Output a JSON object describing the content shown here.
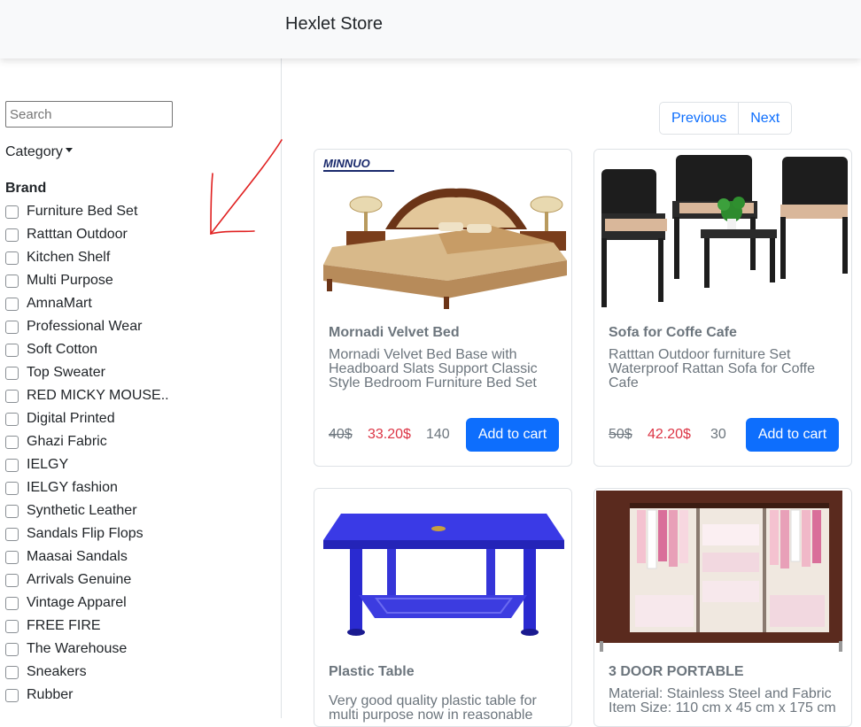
{
  "header": {
    "title": "Hexlet Store"
  },
  "sidebar": {
    "search_placeholder": "Search",
    "category_label": "Category",
    "brand_heading": "Brand",
    "brands": [
      "Furniture Bed Set",
      "Ratttan Outdoor",
      "Kitchen Shelf",
      "Multi Purpose",
      "AmnaMart",
      "Professional Wear",
      "Soft Cotton",
      "Top Sweater",
      "RED MICKY MOUSE..",
      "Digital Printed",
      "Ghazi Fabric",
      "IELGY",
      "IELGY fashion",
      "Synthetic Leather",
      "Sandals Flip Flops",
      "Maasai Sandals",
      "Arrivals Genuine",
      "Vintage Apparel",
      "FREE FIRE",
      "The Warehouse",
      "Sneakers",
      "Rubber"
    ]
  },
  "pagination": {
    "previous": "Previous",
    "next": "Next"
  },
  "products": [
    {
      "title": "Mornadi Velvet Bed",
      "desc_lines": [
        "Mornadi Velvet Bed Base with",
        "Headboard Slats Support Classic",
        "Style Bedroom Furniture Bed Set"
      ],
      "old_price": "40$",
      "price": "33.20$",
      "stock": "140",
      "button": "Add to cart",
      "logo_text": "MINNUO"
    },
    {
      "title": "Sofa for Coffe Cafe",
      "desc_lines": [
        "Ratttan Outdoor furniture Set",
        "Waterproof Rattan Sofa for Coffe",
        "Cafe"
      ],
      "old_price": "50$",
      "price": "42.20$",
      "stock": "30",
      "button": "Add to cart"
    },
    {
      "title": "Plastic Table",
      "desc_lines": [
        "Very good quality plastic table for",
        "multi purpose now in reasonable"
      ]
    },
    {
      "title": "3 DOOR PORTABLE",
      "desc_lines": [
        "Material: Stainless Steel and Fabric",
        "Item Size: 110 cm x 45 cm x 175 cm"
      ]
    }
  ],
  "colors": {
    "accent": "#0d6efd",
    "sale": "#dc3545",
    "muted": "#6c757d",
    "annotation": "#e02020"
  }
}
